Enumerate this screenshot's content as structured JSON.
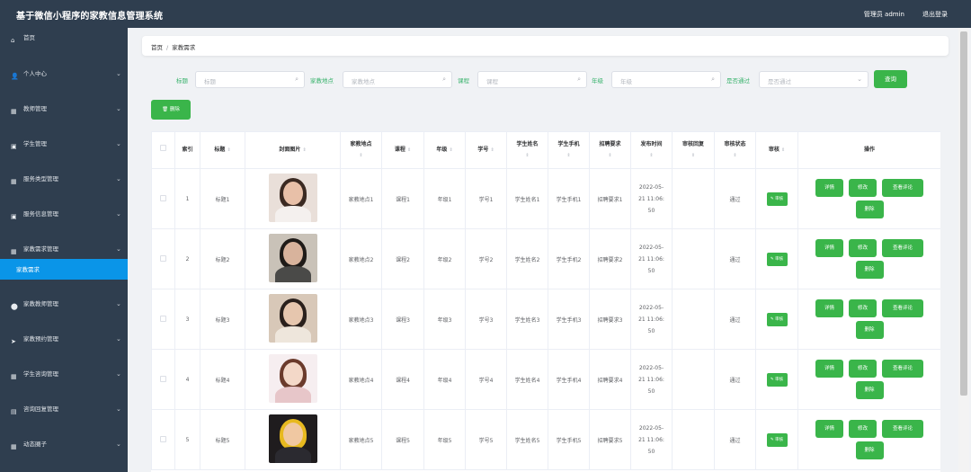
{
  "header": {
    "title": "基于微信小程序的家教信息管理系统",
    "admin_label": "管理员 admin",
    "logout": "退出登录",
    "bg": "#2f3e4f"
  },
  "sidebar": {
    "items": [
      {
        "icon": "home-icon",
        "label": "首页",
        "arrow": false
      },
      {
        "icon": "user-icon",
        "label": "个人中心",
        "arrow": true
      },
      {
        "icon": "grid-icon",
        "label": "教师管理",
        "arrow": true
      },
      {
        "icon": "book-icon",
        "label": "学生管理",
        "arrow": true
      },
      {
        "icon": "grid-icon",
        "label": "服务类型管理",
        "arrow": true
      },
      {
        "icon": "book-icon",
        "label": "服务信息管理",
        "arrow": true
      },
      {
        "icon": "grid-icon",
        "label": "家教需求管理",
        "arrow": true,
        "expanded": true
      },
      {
        "icon": "tag-icon",
        "label": "家教教师管理",
        "arrow": true
      },
      {
        "icon": "send-icon",
        "label": "家教预约管理",
        "arrow": true
      },
      {
        "icon": "grid-icon",
        "label": "学生咨询管理",
        "arrow": true
      },
      {
        "icon": "chat-icon",
        "label": "咨询回复管理",
        "arrow": true
      },
      {
        "icon": "grid-icon",
        "label": "动态圈子",
        "arrow": true
      }
    ],
    "active_subitem": "家教需求",
    "active_color": "#0a95e8"
  },
  "breadcrumb": {
    "home": "首页",
    "sep": "/",
    "current": "家教需求"
  },
  "search": {
    "fields": [
      {
        "label": "标题",
        "placeholder": "标题"
      },
      {
        "label": "家教地点",
        "placeholder": "家教地点"
      },
      {
        "label": "课程",
        "placeholder": "课程"
      },
      {
        "label": "年级",
        "placeholder": "年级"
      },
      {
        "label": "是否通过",
        "placeholder": "是否通过"
      }
    ],
    "button": "查询",
    "delete_button": "删除"
  },
  "table": {
    "columns": [
      "索引",
      "标题",
      "封面图片",
      "家教地点",
      "课程",
      "年级",
      "学号",
      "学生姓名",
      "学生手机",
      "招聘要求",
      "发布时间",
      "审核回复",
      "审核状态",
      "审核",
      "操作"
    ],
    "audit_label": "审核",
    "actions": [
      "详情",
      "修改",
      "查看评论",
      "删除"
    ],
    "rows": [
      {
        "index": "1",
        "title": "标题1",
        "place": "家教地点1",
        "course": "课程1",
        "grade": "年级1",
        "sno": "学号1",
        "sname": "学生姓名1",
        "phone": "学生手机1",
        "req": "招聘要求1",
        "time1": "2022-05-",
        "time2": "21 11:06:",
        "time3": "50",
        "reply": "",
        "status": "通过"
      },
      {
        "index": "2",
        "title": "标题2",
        "place": "家教地点2",
        "course": "课程2",
        "grade": "年级2",
        "sno": "学号2",
        "sname": "学生姓名2",
        "phone": "学生手机2",
        "req": "招聘要求2",
        "time1": "2022-05-",
        "time2": "21 11:06:",
        "time3": "50",
        "reply": "",
        "status": "通过"
      },
      {
        "index": "3",
        "title": "标题3",
        "place": "家教地点3",
        "course": "课程3",
        "grade": "年级3",
        "sno": "学号3",
        "sname": "学生姓名3",
        "phone": "学生手机3",
        "req": "招聘要求3",
        "time1": "2022-05-",
        "time2": "21 11:06:",
        "time3": "50",
        "reply": "",
        "status": "通过"
      },
      {
        "index": "4",
        "title": "标题4",
        "place": "家教地点4",
        "course": "课程4",
        "grade": "年级4",
        "sno": "学号4",
        "sname": "学生姓名4",
        "phone": "学生手机4",
        "req": "招聘要求4",
        "time1": "2022-05-",
        "time2": "21 11:06:",
        "time3": "50",
        "reply": "",
        "status": "通过"
      },
      {
        "index": "5",
        "title": "标题5",
        "place": "家教地点5",
        "course": "课程5",
        "grade": "年级5",
        "sno": "学号5",
        "sname": "学生姓名5",
        "phone": "学生手机5",
        "req": "招聘要求5",
        "time1": "2022-05-",
        "time2": "21 11:06:",
        "time3": "50",
        "reply": "",
        "status": "通过"
      }
    ]
  },
  "colors": {
    "accent_green": "#3ab54a",
    "label_green": "#3ab36d"
  }
}
